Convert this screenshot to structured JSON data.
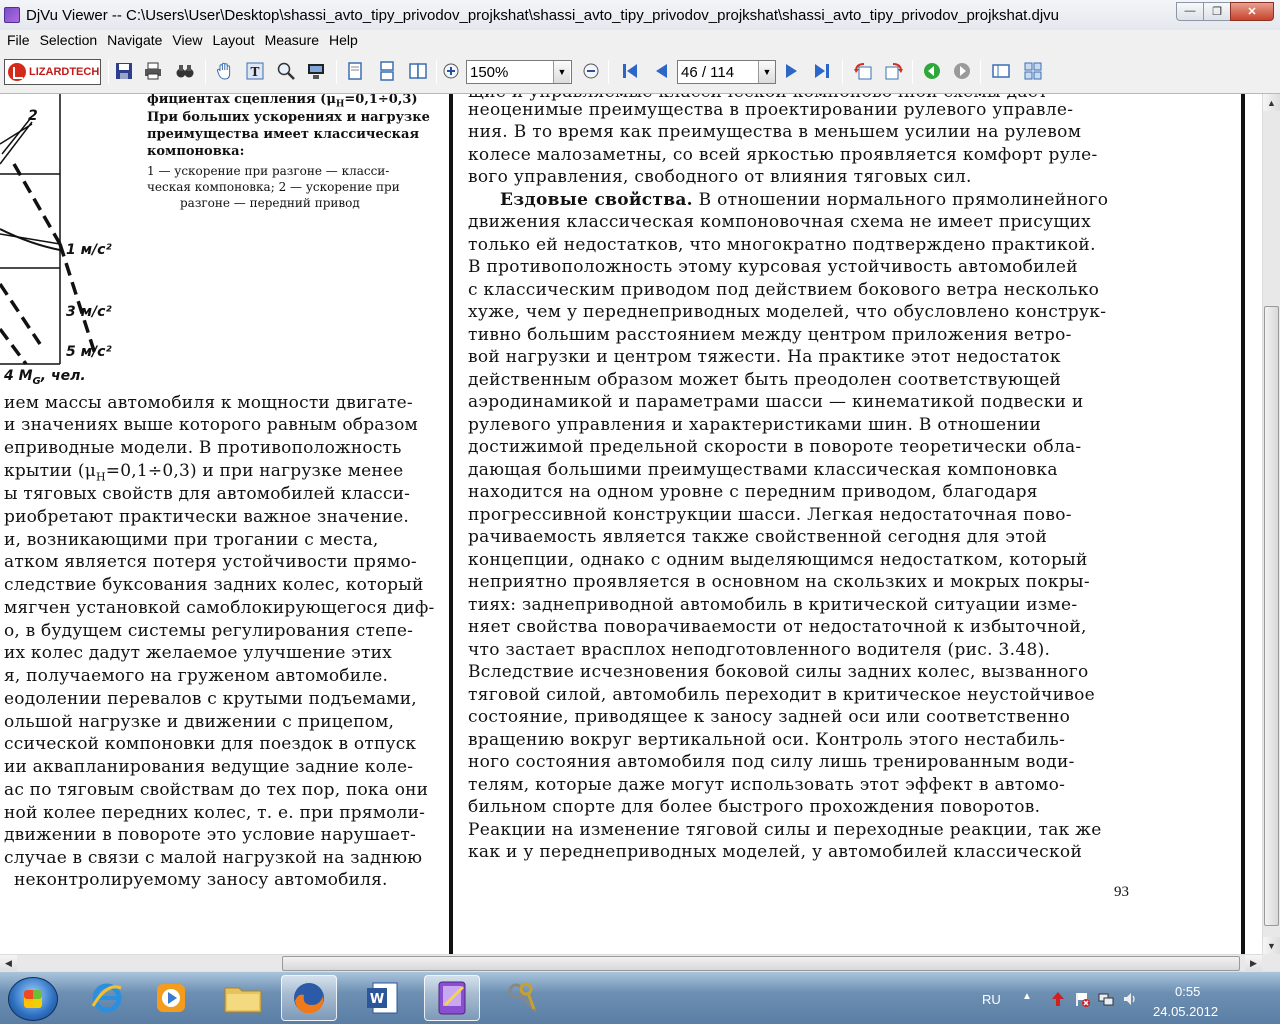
{
  "window": {
    "title": "DjVu Viewer -- C:\\Users\\User\\Desktop\\shassi_avto_tipy_privodov_projkshat\\shassi_avto_tipy_privodov_projkshat\\shassi_avto_tipy_privodov_projkshat.djvu",
    "minimize_icon": "minimize-icon",
    "maximize_icon": "restore-icon",
    "close_icon": "close-icon"
  },
  "menu": [
    "File",
    "Selection",
    "Navigate",
    "View",
    "Layout",
    "Measure",
    "Help"
  ],
  "toolbar": {
    "logo_text": "LIZARDTECH",
    "zoom_value": "150%",
    "page_value": "46 / 114",
    "icons": [
      "save-icon",
      "print-icon",
      "find-binoculars-icon",
      "pan-hand-icon",
      "text-select-icon",
      "zoom-tool-icon",
      "snapshot-icon",
      "single-page-icon",
      "continuous-page-icon",
      "facing-pages-icon",
      "zoom-in-icon",
      "zoom-out-icon",
      "first-page-icon",
      "previous-page-icon",
      "next-page-icon",
      "last-page-icon",
      "rotate-left-icon",
      "rotate-right-icon",
      "back-icon",
      "forward-icon",
      "thumbnails-icon",
      "outline-icon"
    ]
  },
  "left_page": {
    "caption_lines": [
      "фициентах сцепления  (μ",
      "При больших ускорениях и нагрузке",
      "преимущества имеет классическая",
      "компоновка:",
      "1 — ускорение  при  разгоне — класси-",
      "ческая компоновка;  2 — ускорение при",
      "разгоне — передний   привод"
    ],
    "caption_formula_tail": "=0,1÷0,3)",
    "chart_labels": [
      "2",
      "1 м/с²",
      "3 м/с²",
      "5 м/с²",
      "4 M",
      ", чел."
    ],
    "body_lines": [
      "ием массы автомобиля к мощности двигате-",
      "и значениях выше которого равным образом",
      "еприводные модели. В противоположность",
      "крытии (μ",
      "=0,1÷0,3) и при нагрузке менее",
      "ы тяговых свойств для автомобилей класси-",
      "риобретают практически важное значение.",
      "и, возникающими при трогании с места,",
      "атком является потеря устойчивости прямо-",
      "следствие буксования задних колес, который",
      "мягчен установкой самоблокирующегося диф-",
      "о, в будущем системы регулирования степе-",
      "их колес дадут желаемое улучшение этих",
      "я, получаемого на груженом автомобиле.",
      "еодолении перевалов с крутыми подъемами,",
      "ольшой нагрузке и движении с прицепом,",
      "ссической компоновки для поездок в отпуск",
      "ии аквапланирования ведущие задние коле-",
      "ас по тяговым свойствам до тех пор, пока они",
      "ной колее передних колес, т. е. при прямоли-",
      " движении в повороте это условие нарушает-",
      "случае в связи с малой нагрузкой на заднюю",
      "неконтролируемому заносу автомобиля."
    ]
  },
  "right_page": {
    "top_cut_line": "щие и управляемые классической компоновочной схемы дает",
    "lines": [
      "неоценимые преимущества в проектировании рулевого управле-",
      "ния. В то время как преимущества в меньшем усилии на рулевом",
      "колесе малозаметны, со всей яркостью проявляется комфорт руле-",
      "вого управления, свободного от влияния тяговых сил.",
      "Ездовые свойства.",
      " В отношении нормального прямолинейного",
      "движения классическая компоновочная схема не имеет присущих",
      "только ей недостатков, что многократно подтверждено практикой.",
      "В противоположность этому курсовая устойчивость автомобилей",
      "с классическим приводом под действием бокового ветра несколько",
      "хуже, чем у переднеприводных моделей, что обусловлено конструк-",
      "тивно большим расстоянием между центром приложения ветро-",
      "вой нагрузки и центром тяжести. На практике этот недостаток",
      "действенным образом может быть преодолен соответствующей",
      "аэродинамикой и параметрами шасси — кинематикой подвески и",
      "рулевого управления и характеристиками шин. В отношении",
      "достижимой предельной скорости в повороте теоретически обла-",
      "дающая большими преимуществами классическая компоновка",
      "находится на одном уровне с передним приводом, благодаря",
      "прогрессивной конструкции шасси. Легкая недостаточная пово-",
      "рачиваемость является также свойственной сегодня для этой",
      "концепции, однако с одним выделяющимся недостатком, который",
      "неприятно проявляется в основном на скользких и мокрых покры-",
      "тиях: заднеприводной автомобиль в критической ситуации изме-",
      "няет свойства поворачиваемости от недостаточной к избыточной,",
      "что застает врасплох неподготовленного водителя (рис. 3.48).",
      "Вследствие исчезновения боковой силы задних колес, вызванного",
      "тяговой силой, автомобиль переходит в критическое неустойчивое",
      "состояние, приводящее к заносу задней оси или соответственно",
      "вращению вокруг вертикальной оси. Контроль этого нестабиль-",
      "ного состояния автомобиля под силу лишь тренированным води-",
      "телям, которые даже могут использовать этот эффект в автомо-",
      "бильном спорте для более быстрого прохождения поворотов.",
      "Реакции на изменение тяговой силы и переходные реакции, так же",
      "как и у переднеприводных моделей, у автомобилей классической"
    ],
    "page_number": "93"
  },
  "taskbar": {
    "apps": [
      "windows-start-icon",
      "internet-explorer-icon",
      "media-player-icon",
      "windows-explorer-icon",
      "firefox-icon",
      "word-icon",
      "djvu-viewer-icon",
      "keys-utility-icon"
    ],
    "language": "RU",
    "time": "0:55",
    "date": "24.05.2012"
  }
}
